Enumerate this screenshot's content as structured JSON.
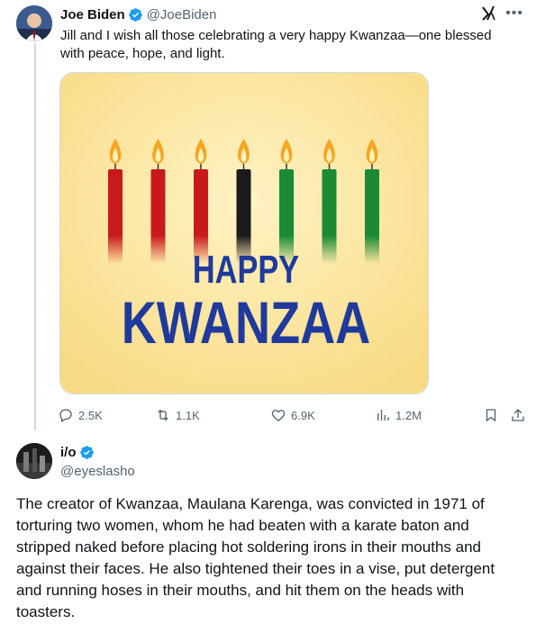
{
  "post": {
    "author_name": "Joe Biden",
    "author_handle": "@JoeBiden",
    "text": "Jill and I wish all those celebrating a very happy Kwanzaa—one blessed with peace, hope, and light.",
    "image_text": {
      "line1": "HAPPY",
      "line2": "KWANZAA"
    },
    "candle_colors": [
      "#c8191c",
      "#c8191c",
      "#c8191c",
      "#1a1a1a",
      "#1a8a34",
      "#1a8a34",
      "#1a8a34"
    ],
    "stats": {
      "replies": "2.5K",
      "reposts": "1.1K",
      "likes": "6.9K",
      "views": "1.2M"
    }
  },
  "reply": {
    "author_name": "i/o",
    "author_handle": "@eyeslasho",
    "text": "The creator of Kwanzaa, Maulana Karenga, was convicted in 1971 of torturing two women, whom he had beaten with a karate baton and stripped naked before placing hot soldering irons in their mouths and against their faces. He also tightened their toes in a vise, put detergent and running hoses in their mouths, and hit them on the heads with toasters."
  },
  "colors": {
    "verified": "#1d9bf0",
    "text": "#0f1419",
    "muted": "#536471",
    "image_bg": "#fbe49a",
    "image_text": "#1f3a9c"
  },
  "icons": [
    "verified-badge-icon",
    "grok-icon",
    "more-icon",
    "reply-icon",
    "repost-icon",
    "like-icon",
    "views-icon",
    "bookmark-icon",
    "share-icon"
  ]
}
